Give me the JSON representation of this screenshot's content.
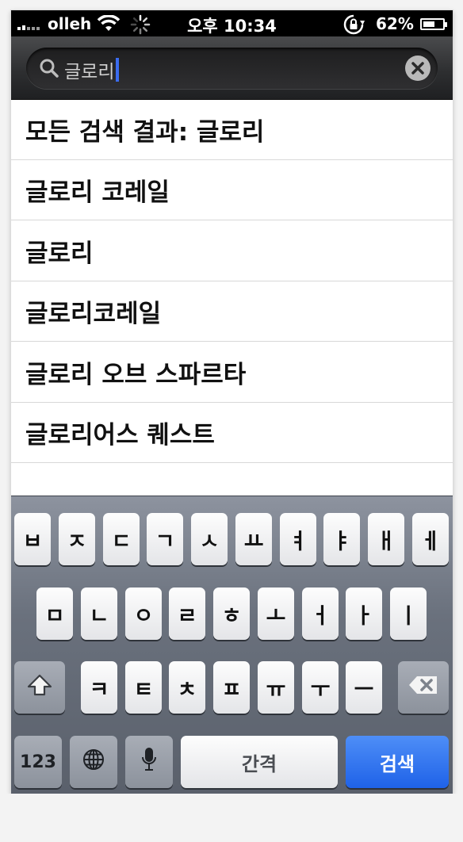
{
  "status_bar": {
    "carrier": "olleh",
    "time": "오후 10:34",
    "battery_percent_text": "62%",
    "battery_level": 0.62
  },
  "search": {
    "value": "글로리",
    "icon": "magnifier-icon",
    "clear_icon": "clear-x-icon"
  },
  "suggestions": [
    "모든 검색 결과: 글로리",
    "글로리 코레일",
    "글로리",
    "글로리코레일",
    "글로리 오브 스파르타",
    "글로리어스 퀘스트"
  ],
  "keyboard": {
    "row1": [
      "ㅂ",
      "ㅈ",
      "ㄷ",
      "ㄱ",
      "ㅅ",
      "ㅛ",
      "ㅕ",
      "ㅑ",
      "ㅐ",
      "ㅔ"
    ],
    "row2": [
      "ㅁ",
      "ㄴ",
      "ㅇ",
      "ㄹ",
      "ㅎ",
      "ㅗ",
      "ㅓ",
      "ㅏ",
      "ㅣ"
    ],
    "row3": [
      "ㅋ",
      "ㅌ",
      "ㅊ",
      "ㅍ",
      "ㅠ",
      "ㅜ",
      "ㅡ"
    ],
    "numbers_label": "123",
    "space_label": "간격",
    "search_label": "검색",
    "shift_icon": "shift-arrow-icon",
    "delete_icon": "backspace-icon",
    "globe_icon": "globe-icon",
    "mic_icon": "microphone-icon"
  },
  "colors": {
    "accent_blue": "#1f62e8",
    "caret": "#3b6cf0"
  }
}
